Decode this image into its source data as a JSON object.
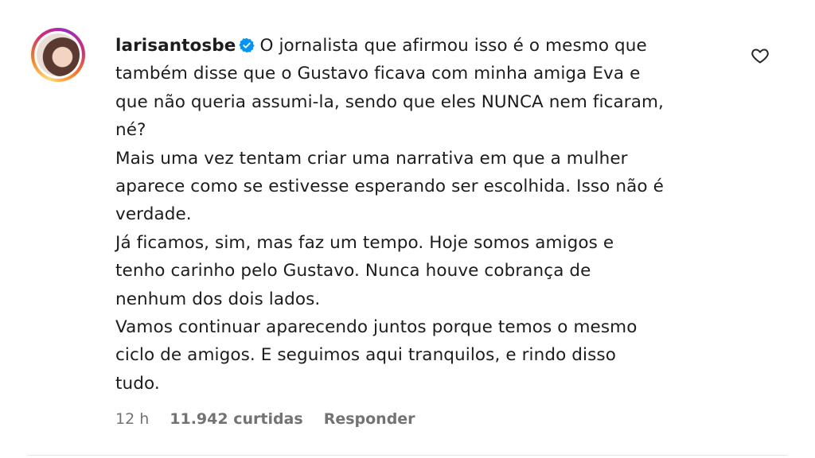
{
  "comment": {
    "username": "larisantosbe",
    "verified": true,
    "lines": [
      "O jornalista que afirmou isso é o mesmo que",
      "também disse que o Gustavo ficava com minha amiga Eva e",
      "que não queria assumi-la, sendo que eles NUNCA nem ficaram,",
      "né?",
      "Mais uma vez tentam criar uma narrativa em que a mulher",
      "aparece como se estivesse esperando ser escolhida. Isso não é",
      "verdade.",
      "Já ficamos, sim, mas faz um tempo. Hoje somos amigos e",
      "tenho carinho pelo Gustavo. Nunca houve cobrança de",
      "nenhum dos dois lados.",
      "Vamos continuar aparecendo juntos porque temos o mesmo",
      "ciclo de amigos. E seguimos aqui tranquilos, e rindo disso",
      "tudo."
    ],
    "time": "12 h",
    "likes": "11.942 curtidas",
    "reply_label": "Responder"
  },
  "icons": {
    "verified": "verified-badge-icon",
    "like": "heart-icon"
  },
  "colors": {
    "verified_blue": "#0095f6",
    "meta_gray": "#737373"
  }
}
